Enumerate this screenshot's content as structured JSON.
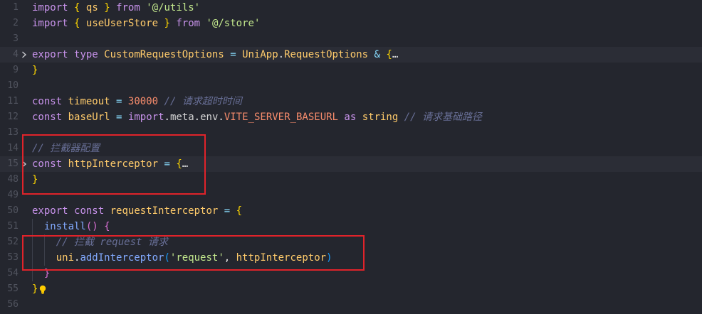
{
  "editor": {
    "lines": [
      {
        "num": "1",
        "tokens": [
          [
            "kw",
            "import"
          ],
          [
            "wh",
            " "
          ],
          [
            "bk",
            "{"
          ],
          [
            "wh",
            " "
          ],
          [
            "vr",
            "qs"
          ],
          [
            "wh",
            " "
          ],
          [
            "bk",
            "}"
          ],
          [
            "wh",
            " "
          ],
          [
            "kw",
            "from"
          ],
          [
            "wh",
            " "
          ],
          [
            "st",
            "'@/utils'"
          ]
        ]
      },
      {
        "num": "2",
        "tokens": [
          [
            "kw",
            "import"
          ],
          [
            "wh",
            " "
          ],
          [
            "bk",
            "{"
          ],
          [
            "wh",
            " "
          ],
          [
            "vr",
            "useUserStore"
          ],
          [
            "wh",
            " "
          ],
          [
            "bk",
            "}"
          ],
          [
            "wh",
            " "
          ],
          [
            "kw",
            "from"
          ],
          [
            "wh",
            " "
          ],
          [
            "st",
            "'@/store'"
          ]
        ]
      },
      {
        "num": "3",
        "tokens": []
      },
      {
        "num": "4",
        "folded": true,
        "tokens": [
          [
            "kw",
            "export"
          ],
          [
            "wh",
            " "
          ],
          [
            "kw",
            "type"
          ],
          [
            "wh",
            " "
          ],
          [
            "ty",
            "CustomRequestOptions"
          ],
          [
            "wh",
            " "
          ],
          [
            "op",
            "="
          ],
          [
            "wh",
            " "
          ],
          [
            "ty",
            "UniApp"
          ],
          [
            "wh",
            "."
          ],
          [
            "ty",
            "RequestOptions"
          ],
          [
            "wh",
            " "
          ],
          [
            "op",
            "&"
          ],
          [
            "wh",
            " "
          ],
          [
            "bk",
            "{"
          ],
          [
            "wh",
            "…"
          ]
        ]
      },
      {
        "num": "9",
        "tokens": [
          [
            "bk",
            "}"
          ]
        ]
      },
      {
        "num": "10",
        "tokens": []
      },
      {
        "num": "11",
        "tokens": [
          [
            "kw",
            "const"
          ],
          [
            "wh",
            " "
          ],
          [
            "vr",
            "timeout"
          ],
          [
            "wh",
            " "
          ],
          [
            "op",
            "="
          ],
          [
            "wh",
            " "
          ],
          [
            "nm",
            "30000"
          ],
          [
            "wh",
            " "
          ],
          [
            "cm",
            "// 请求超时时间"
          ]
        ]
      },
      {
        "num": "12",
        "tokens": [
          [
            "kw",
            "const"
          ],
          [
            "wh",
            " "
          ],
          [
            "vr",
            "baseUrl"
          ],
          [
            "wh",
            " "
          ],
          [
            "op",
            "="
          ],
          [
            "wh",
            " "
          ],
          [
            "kw",
            "import"
          ],
          [
            "wh",
            "."
          ],
          [
            "mb",
            "meta"
          ],
          [
            "wh",
            "."
          ],
          [
            "mb",
            "env"
          ],
          [
            "wh",
            "."
          ],
          [
            "pn",
            "VITE_SERVER_BASEURL"
          ],
          [
            "wh",
            " "
          ],
          [
            "kw",
            "as"
          ],
          [
            "wh",
            " "
          ],
          [
            "ty",
            "string"
          ],
          [
            "wh",
            " "
          ],
          [
            "cm",
            "// 请求基础路径"
          ]
        ]
      },
      {
        "num": "13",
        "tokens": []
      },
      {
        "num": "14",
        "tokens": [
          [
            "cm",
            "// 拦截器配置"
          ]
        ]
      },
      {
        "num": "15",
        "folded": true,
        "tokens": [
          [
            "kw",
            "const"
          ],
          [
            "wh",
            " "
          ],
          [
            "vr",
            "httpInterceptor"
          ],
          [
            "wh",
            " "
          ],
          [
            "op",
            "="
          ],
          [
            "wh",
            " "
          ],
          [
            "bk",
            "{"
          ],
          [
            "wh",
            "…"
          ]
        ]
      },
      {
        "num": "48",
        "tokens": [
          [
            "bk",
            "}"
          ]
        ]
      },
      {
        "num": "49",
        "tokens": []
      },
      {
        "num": "50",
        "tokens": [
          [
            "kw",
            "export"
          ],
          [
            "wh",
            " "
          ],
          [
            "kw",
            "const"
          ],
          [
            "wh",
            " "
          ],
          [
            "vr",
            "requestInterceptor"
          ],
          [
            "wh",
            " "
          ],
          [
            "op",
            "="
          ],
          [
            "wh",
            " "
          ],
          [
            "bk",
            "{"
          ]
        ]
      },
      {
        "num": "51",
        "tokens": [
          [
            "wh",
            "  "
          ],
          [
            "fn",
            "install"
          ],
          [
            "bk2",
            "()"
          ],
          [
            "wh",
            " "
          ],
          [
            "bk2",
            "{"
          ]
        ]
      },
      {
        "num": "52",
        "tokens": [
          [
            "wh",
            "    "
          ],
          [
            "cm",
            "// 拦截 request 请求"
          ]
        ]
      },
      {
        "num": "53",
        "tokens": [
          [
            "wh",
            "    "
          ],
          [
            "vr",
            "uni"
          ],
          [
            "wh",
            "."
          ],
          [
            "fn",
            "addInterceptor"
          ],
          [
            "bk3",
            "("
          ],
          [
            "st",
            "'request'"
          ],
          [
            "wh",
            ", "
          ],
          [
            "vr",
            "httpInterceptor"
          ],
          [
            "bk3",
            ")"
          ]
        ]
      },
      {
        "num": "54",
        "tokens": [
          [
            "wh",
            "  "
          ],
          [
            "bk2",
            "}"
          ]
        ]
      },
      {
        "num": "55",
        "tokens": [
          [
            "bk",
            "}"
          ]
        ]
      },
      {
        "num": "56",
        "tokens": []
      }
    ]
  },
  "colors": {
    "highlight_box": "#e0232a",
    "background": "#24262e"
  },
  "icons": {
    "fold": "chevron-right-icon",
    "lightbulb": "lightbulb-icon"
  }
}
